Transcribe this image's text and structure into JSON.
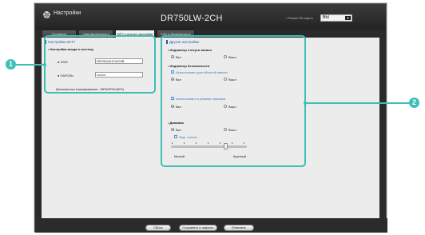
{
  "header": {
    "settings_title": "Настройки",
    "model_title": "DR750LW-2CH",
    "mode_label": "• Режим SD-карты",
    "mode_value": "ВЫ",
    "mode_arrow": "▼"
  },
  "tabs": [
    {
      "label": "Основные"
    },
    {
      "label": "Чувствительность"
    },
    {
      "label": "WiFi и другие настройки"
    },
    {
      "label": "LCD и безопасность"
    }
  ],
  "wifi_panel": {
    "title": "Настройки Wi-Fi",
    "subtitle": "• Настройка входа в систему",
    "ssid_label": "● SSID",
    "ssid_value": "DR750LW-E14C0B",
    "password_label": "● ПАРОЛЬ",
    "password_value": "••••••••",
    "security_label": "(Безопасность/шифрование : WPA2PSK/AES)"
  },
  "other_panel": {
    "title": "Другие настройки",
    "record_status_title": "• Индикатор статуса записи",
    "on_label": "Вкл",
    "off_label": "Выкл",
    "security_indicator_title": "• Индикатор безопасности",
    "normal_mode_label": "Использовать для обычной записи",
    "parking_mode_label": "Использовать в режиме парковки",
    "speaker_title": "• Динамик",
    "volume_label": "Звук. сигнал",
    "slider_min_label": "Малый",
    "slider_max_label": "Крупный",
    "volume_level_fraction": 0.72
  },
  "footer": {
    "reset_label": "Сброс",
    "save_close_label": "Сохранить и закрыть",
    "cancel_label": "Отменить"
  },
  "callouts": {
    "badge_1": "1",
    "badge_2": "2"
  },
  "colors": {
    "callout": "#3dbfb6",
    "section_blue": "#1f5fa8"
  }
}
